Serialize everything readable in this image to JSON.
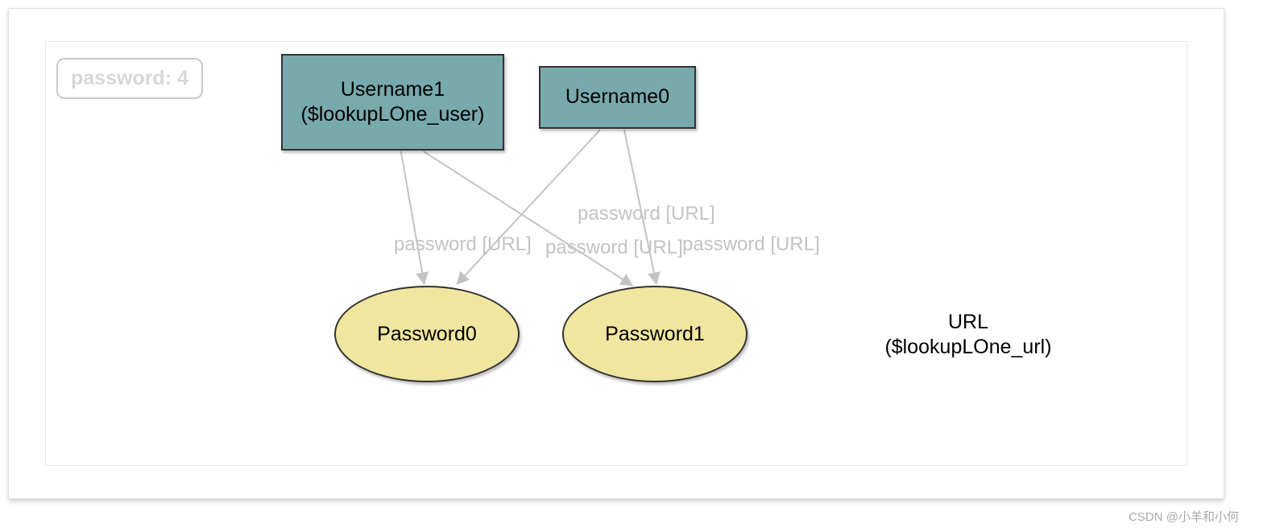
{
  "legend": {
    "text": "password: 4"
  },
  "nodes": {
    "username1": {
      "line1": "Username1",
      "line2": "($lookupLOne_user)"
    },
    "username0": {
      "label": "Username0"
    },
    "password0": {
      "label": "Password0"
    },
    "password1": {
      "label": "Password1"
    },
    "url": {
      "line1": "URL",
      "line2": "($lookupLOne_url)"
    }
  },
  "edges": {
    "e1": "password [URL]",
    "e2": "password [URL]",
    "e3": "password [URL]",
    "e4": "password [URL]"
  },
  "watermark": "CSDN @小羊和小何"
}
